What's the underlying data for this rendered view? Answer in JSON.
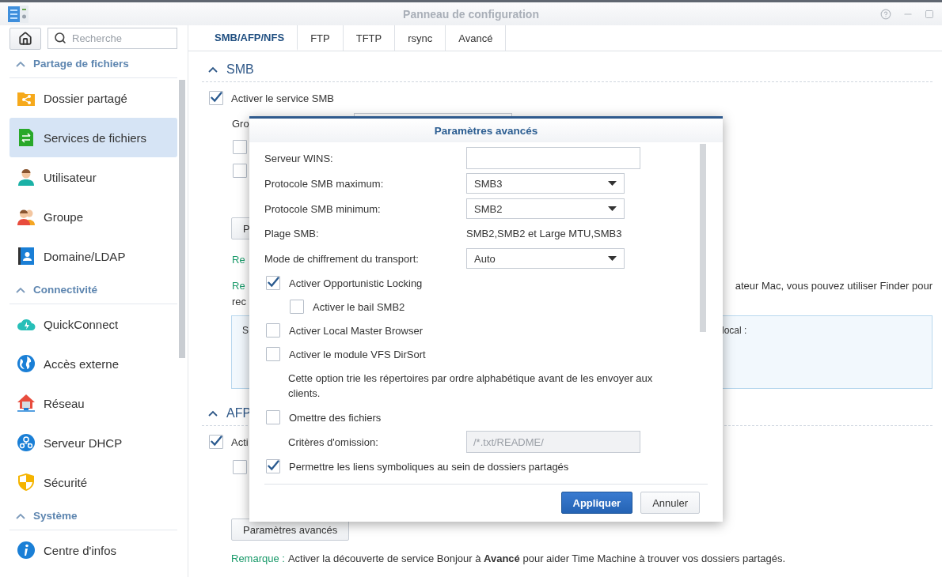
{
  "window": {
    "title": "Panneau de configuration"
  },
  "sidebar": {
    "search": {
      "placeholder": "Recherche"
    },
    "groups": [
      {
        "label": "Partage de fichiers",
        "expanded": true,
        "items": [
          {
            "label": "Dossier partagé",
            "selected": false
          },
          {
            "label": "Services de fichiers",
            "selected": true
          },
          {
            "label": "Utilisateur",
            "selected": false
          },
          {
            "label": "Groupe",
            "selected": false
          },
          {
            "label": "Domaine/LDAP",
            "selected": false
          }
        ]
      },
      {
        "label": "Connectivité",
        "expanded": true,
        "items": [
          {
            "label": "QuickConnect",
            "selected": false
          },
          {
            "label": "Accès externe",
            "selected": false
          },
          {
            "label": "Réseau",
            "selected": false
          },
          {
            "label": "Serveur DHCP",
            "selected": false
          },
          {
            "label": "Sécurité",
            "selected": false
          }
        ]
      },
      {
        "label": "Système",
        "expanded": true,
        "items": [
          {
            "label": "Centre d'infos",
            "selected": false
          }
        ]
      }
    ]
  },
  "tabs": [
    {
      "label": "SMB/AFP/NFS",
      "selected": true
    },
    {
      "label": "FTP",
      "selected": false
    },
    {
      "label": "TFTP",
      "selected": false
    },
    {
      "label": "rsync",
      "selected": false
    },
    {
      "label": "Avancé",
      "selected": false
    }
  ],
  "smb_section": {
    "title": "SMB",
    "expanded": true,
    "enable": {
      "label": "Activer le service SMB",
      "checked": true
    },
    "workgroup_label": "Gro",
    "options": [
      {
        "checked": false
      },
      {
        "checked": false
      }
    ],
    "button_label": "P",
    "remark_1": "Re",
    "remark_2": {
      "label": "Re",
      "tail": "ateur Mac, vous pouvez utiliser Finder pour",
      "second_line": "rec"
    },
    "info_box": {
      "left": "S",
      "right": "local :"
    }
  },
  "afp_section": {
    "title": "AFP",
    "expanded": true,
    "enable": {
      "label": "Acti",
      "checked": true
    },
    "options": [
      {
        "checked": false
      }
    ],
    "button_label": "Paramètres avancés",
    "remark": {
      "label": "Remarque :",
      "text": "Activer la découverte de service Bonjour à **Avancé** pour aider Time Machine à trouver vos dossiers partagés."
    }
  },
  "dialog": {
    "title": "Paramètres avancés",
    "rows": [
      {
        "kind": "input",
        "label": "Serveur WINS:"
      },
      {
        "kind": "select",
        "label": "Protocole SMB maximum:",
        "value": "SMB3"
      },
      {
        "kind": "select",
        "label": "Protocole SMB minimum:",
        "value": "SMB2"
      },
      {
        "kind": "text",
        "label": "Plage SMB:",
        "value": "SMB2,SMB2 et Large MTU,SMB3"
      },
      {
        "kind": "select",
        "label": "Mode de chiffrement du transport:",
        "value": "Auto"
      },
      {
        "kind": "checkbox",
        "label": "Activer Opportunistic Locking",
        "checked": true,
        "children": [
          {
            "kind": "checkbox",
            "label": "Activer le bail SMB2",
            "checked": false
          }
        ]
      },
      {
        "kind": "checkbox",
        "label": "Activer Local Master Browser",
        "checked": false
      },
      {
        "kind": "checkbox",
        "label": "Activer le module VFS DirSort",
        "checked": false,
        "children": [
          {
            "kind": "note",
            "text": "Cette option trie les répertoires par ordre alphabétique avant de les envoyer aux clients."
          }
        ]
      },
      {
        "kind": "checkbox",
        "label": "Omettre des fichiers",
        "checked": false,
        "children": [
          {
            "kind": "input",
            "label": "Critères d'omission:",
            "placeholder": "/*.txt/README/",
            "disabled": true
          }
        ]
      },
      {
        "kind": "checkbox",
        "label": "Permettre les liens symboliques au sein de dossiers partagés",
        "checked": true
      }
    ],
    "buttons": [
      {
        "label": "Appliquer",
        "kind": "primary"
      },
      {
        "label": "Annuler",
        "kind": "secondary"
      }
    ]
  }
}
